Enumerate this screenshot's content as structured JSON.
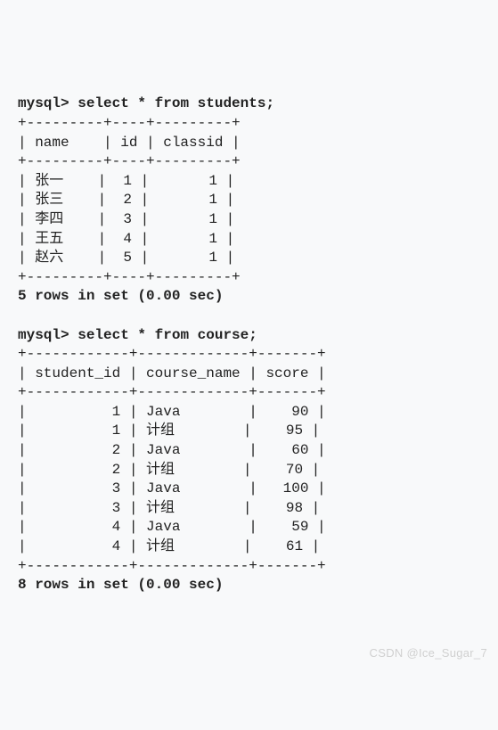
{
  "query1": {
    "prompt": "mysql> ",
    "sql": "select * from students;",
    "border_top": "+---------+----+---------+",
    "header": "| name    | id | classid |",
    "border_mid": "+---------+----+---------+",
    "rows": [
      "| 张一    |  1 |       1 |",
      "| 张三    |  2 |       1 |",
      "| 李四    |  3 |       1 |",
      "| 王五    |  4 |       1 |",
      "| 赵六    |  5 |       1 |"
    ],
    "border_bottom": "+---------+----+---------+",
    "status": "5 rows in set (0.00 sec)"
  },
  "query2": {
    "prompt": "mysql> ",
    "sql": "select * from course;",
    "border_top": "+------------+-------------+-------+",
    "header": "| student_id | course_name | score |",
    "border_mid": "+------------+-------------+-------+",
    "rows": [
      "|          1 | Java        |    90 |",
      "|          1 | 计组        |    95 |",
      "|          2 | Java        |    60 |",
      "|          2 | 计组        |    70 |",
      "|          3 | Java        |   100 |",
      "|          3 | 计组        |    98 |",
      "|          4 | Java        |    59 |",
      "|          4 | 计组        |    61 |"
    ],
    "border_bottom": "+------------+-------------+-------+",
    "status": "8 rows in set (0.00 sec)"
  },
  "chart_data": [
    {
      "type": "table",
      "title": "students",
      "columns": [
        "name",
        "id",
        "classid"
      ],
      "rows": [
        [
          "张一",
          1,
          1
        ],
        [
          "张三",
          2,
          1
        ],
        [
          "李四",
          3,
          1
        ],
        [
          "王五",
          4,
          1
        ],
        [
          "赵六",
          5,
          1
        ]
      ]
    },
    {
      "type": "table",
      "title": "course",
      "columns": [
        "student_id",
        "course_name",
        "score"
      ],
      "rows": [
        [
          1,
          "Java",
          90
        ],
        [
          1,
          "计组",
          95
        ],
        [
          2,
          "Java",
          60
        ],
        [
          2,
          "计组",
          70
        ],
        [
          3,
          "Java",
          100
        ],
        [
          3,
          "计组",
          98
        ],
        [
          4,
          "Java",
          59
        ],
        [
          4,
          "计组",
          61
        ]
      ]
    }
  ],
  "watermark": "CSDN @Ice_Sugar_7"
}
